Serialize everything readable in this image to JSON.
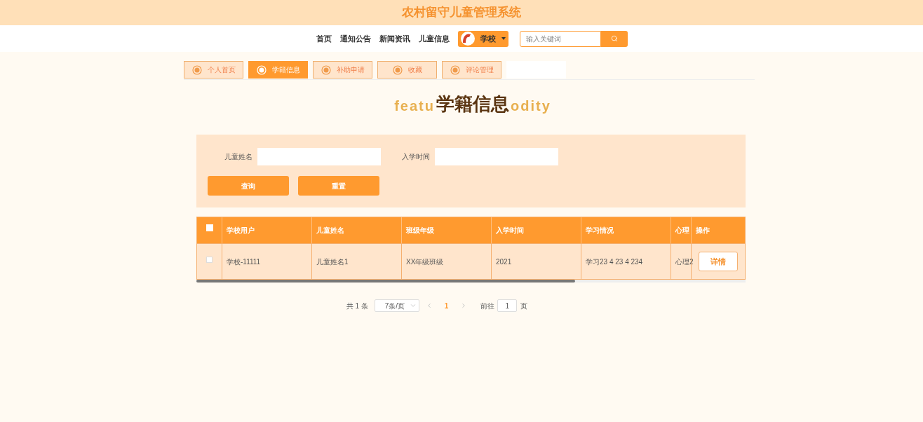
{
  "site_title": "农村留守儿童管理系统",
  "nav": {
    "items": [
      "首页",
      "通知公告",
      "新闻资讯",
      "儿童信息"
    ],
    "user": "学校",
    "search": {
      "placeholder": "输入关键词"
    }
  },
  "tabs": [
    {
      "label": "个人首页",
      "selected": false
    },
    {
      "label": "学籍信息",
      "selected": true
    },
    {
      "label": "补助申请",
      "selected": false
    },
    {
      "label": "收藏",
      "selected": false
    },
    {
      "label": "评论管理",
      "selected": false
    }
  ],
  "page_title": "学籍信息",
  "title_backdrop": [
    "featu",
    "odity"
  ],
  "filters": [
    {
      "label": "儿童姓名"
    },
    {
      "label": "入学时间"
    }
  ],
  "filter_buttons": [
    "查询",
    "重置"
  ],
  "table": {
    "select_all": {
      "checked": false
    },
    "columns": [
      "学校用户",
      "儿童姓名",
      "班级年级",
      "入学时间",
      "学习情况",
      "心理",
      "操作"
    ],
    "rows": [
      {
        "checked": false,
        "cells": [
          "学校-11111",
          "儿童姓名1",
          "XX年级班级",
          "2021",
          "学习23 4 23 4 234",
          "心理2"
        ],
        "action": "详情"
      }
    ]
  },
  "pagination": {
    "total": "共 1 条",
    "page_size": "7条/页",
    "pages": [
      {
        "label": "1",
        "selected": true
      }
    ],
    "goto_label": "前往",
    "goto_value": "1",
    "goto_suffix": "页"
  }
}
